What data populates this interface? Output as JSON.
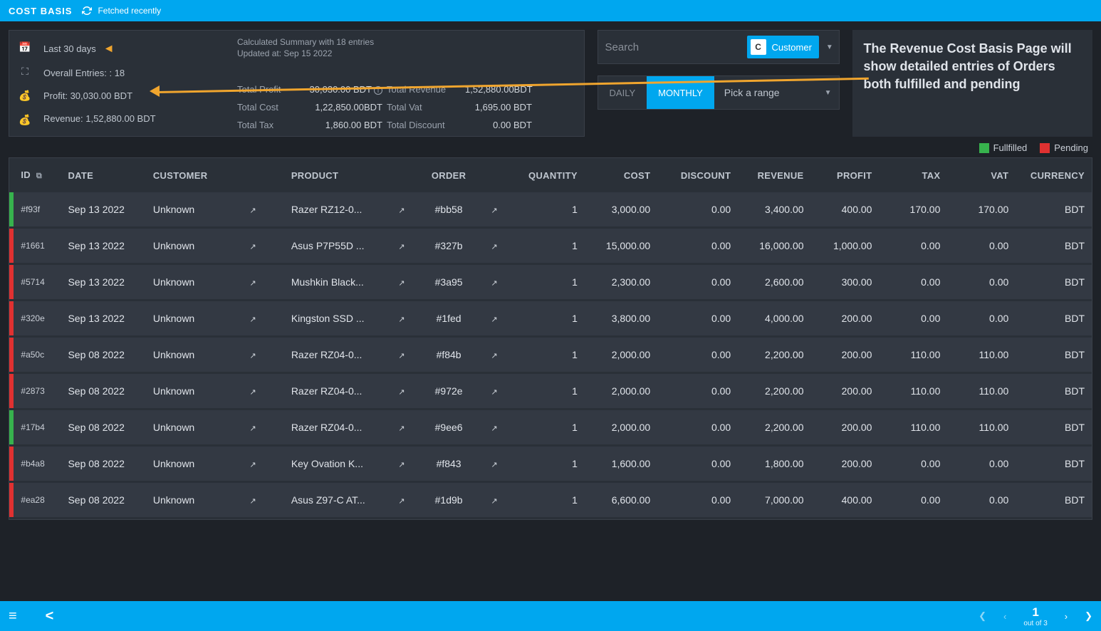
{
  "topbar": {
    "title": "COST BASIS",
    "fetched": "Fetched recently"
  },
  "stats": {
    "range": "Last 30 days",
    "entries": "Overall Entries: : 18",
    "profit": "Profit: 30,030.00 BDT",
    "revenue": "Revenue: 1,52,880.00 BDT"
  },
  "summary": {
    "heading": "Calculated Summary with 18 entries",
    "updated": "Updated at: Sep 15 2022",
    "rows": [
      {
        "l1": "Total Profit",
        "v1": "30,030.00 BDT",
        "l2": "Total Revenue",
        "v2": "1,52,880.00BDT"
      },
      {
        "l1": "Total Cost",
        "v1": "1,22,850.00BDT",
        "l2": "Total Vat",
        "v2": "1,695.00 BDT"
      },
      {
        "l1": "Total Tax",
        "v1": "1,860.00 BDT",
        "l2": "Total Discount",
        "v2": "0.00 BDT"
      }
    ]
  },
  "search": {
    "placeholder": "Search",
    "chip_letter": "C",
    "chip_label": "Customer"
  },
  "range": {
    "daily": "DAILY",
    "monthly": "MONTHLY",
    "pick": "Pick a range"
  },
  "annotation": "The Revenue Cost Basis Page will show detailed entries of Orders both fulfilled and pending",
  "legend": {
    "fulfilled": "Fullfilled",
    "pending": "Pending"
  },
  "colors": {
    "accent": "#00a7ef",
    "fulfilled": "#37b24d",
    "pending": "#e03131",
    "arrow": "#f0a52e"
  },
  "columns": [
    "ID",
    "DATE",
    "CUSTOMER",
    "PRODUCT",
    "ORDER",
    "QUANTITY",
    "COST",
    "DISCOUNT",
    "REVENUE",
    "PROFIT",
    "TAX",
    "VAT",
    "CURRENCY"
  ],
  "rows": [
    {
      "status": "fulfilled",
      "id": "#f93f",
      "date": "Sep 13 2022",
      "customer": "Unknown",
      "product": "Razer RZ12-0...",
      "order": "#bb58",
      "qty": "1",
      "cost": "3,000.00",
      "discount": "0.00",
      "revenue": "3,400.00",
      "profit": "400.00",
      "tax": "170.00",
      "vat": "170.00",
      "currency": "BDT"
    },
    {
      "status": "pending",
      "id": "#1661",
      "date": "Sep 13 2022",
      "customer": "Unknown",
      "product": "Asus P7P55D ...",
      "order": "#327b",
      "qty": "1",
      "cost": "15,000.00",
      "discount": "0.00",
      "revenue": "16,000.00",
      "profit": "1,000.00",
      "tax": "0.00",
      "vat": "0.00",
      "currency": "BDT"
    },
    {
      "status": "pending",
      "id": "#5714",
      "date": "Sep 13 2022",
      "customer": "Unknown",
      "product": "Mushkin Black...",
      "order": "#3a95",
      "qty": "1",
      "cost": "2,300.00",
      "discount": "0.00",
      "revenue": "2,600.00",
      "profit": "300.00",
      "tax": "0.00",
      "vat": "0.00",
      "currency": "BDT"
    },
    {
      "status": "pending",
      "id": "#320e",
      "date": "Sep 13 2022",
      "customer": "Unknown",
      "product": "Kingston SSD ...",
      "order": "#1fed",
      "qty": "1",
      "cost": "3,800.00",
      "discount": "0.00",
      "revenue": "4,000.00",
      "profit": "200.00",
      "tax": "0.00",
      "vat": "0.00",
      "currency": "BDT"
    },
    {
      "status": "pending",
      "id": "#a50c",
      "date": "Sep 08 2022",
      "customer": "Unknown",
      "product": "Razer RZ04-0...",
      "order": "#f84b",
      "qty": "1",
      "cost": "2,000.00",
      "discount": "0.00",
      "revenue": "2,200.00",
      "profit": "200.00",
      "tax": "110.00",
      "vat": "110.00",
      "currency": "BDT"
    },
    {
      "status": "pending",
      "id": "#2873",
      "date": "Sep 08 2022",
      "customer": "Unknown",
      "product": "Razer RZ04-0...",
      "order": "#972e",
      "qty": "1",
      "cost": "2,000.00",
      "discount": "0.00",
      "revenue": "2,200.00",
      "profit": "200.00",
      "tax": "110.00",
      "vat": "110.00",
      "currency": "BDT"
    },
    {
      "status": "fulfilled",
      "id": "#17b4",
      "date": "Sep 08 2022",
      "customer": "Unknown",
      "product": "Razer RZ04-0...",
      "order": "#9ee6",
      "qty": "1",
      "cost": "2,000.00",
      "discount": "0.00",
      "revenue": "2,200.00",
      "profit": "200.00",
      "tax": "110.00",
      "vat": "110.00",
      "currency": "BDT"
    },
    {
      "status": "pending",
      "id": "#b4a8",
      "date": "Sep 08 2022",
      "customer": "Unknown",
      "product": "Key Ovation K...",
      "order": "#f843",
      "qty": "1",
      "cost": "1,600.00",
      "discount": "0.00",
      "revenue": "1,800.00",
      "profit": "200.00",
      "tax": "0.00",
      "vat": "0.00",
      "currency": "BDT"
    },
    {
      "status": "pending",
      "id": "#ea28",
      "date": "Sep 08 2022",
      "customer": "Unknown",
      "product": "Asus Z97-C AT...",
      "order": "#1d9b",
      "qty": "1",
      "cost": "6,600.00",
      "discount": "0.00",
      "revenue": "7,000.00",
      "profit": "400.00",
      "tax": "0.00",
      "vat": "0.00",
      "currency": "BDT"
    }
  ],
  "pager": {
    "page": "1",
    "total": "out of 3"
  }
}
